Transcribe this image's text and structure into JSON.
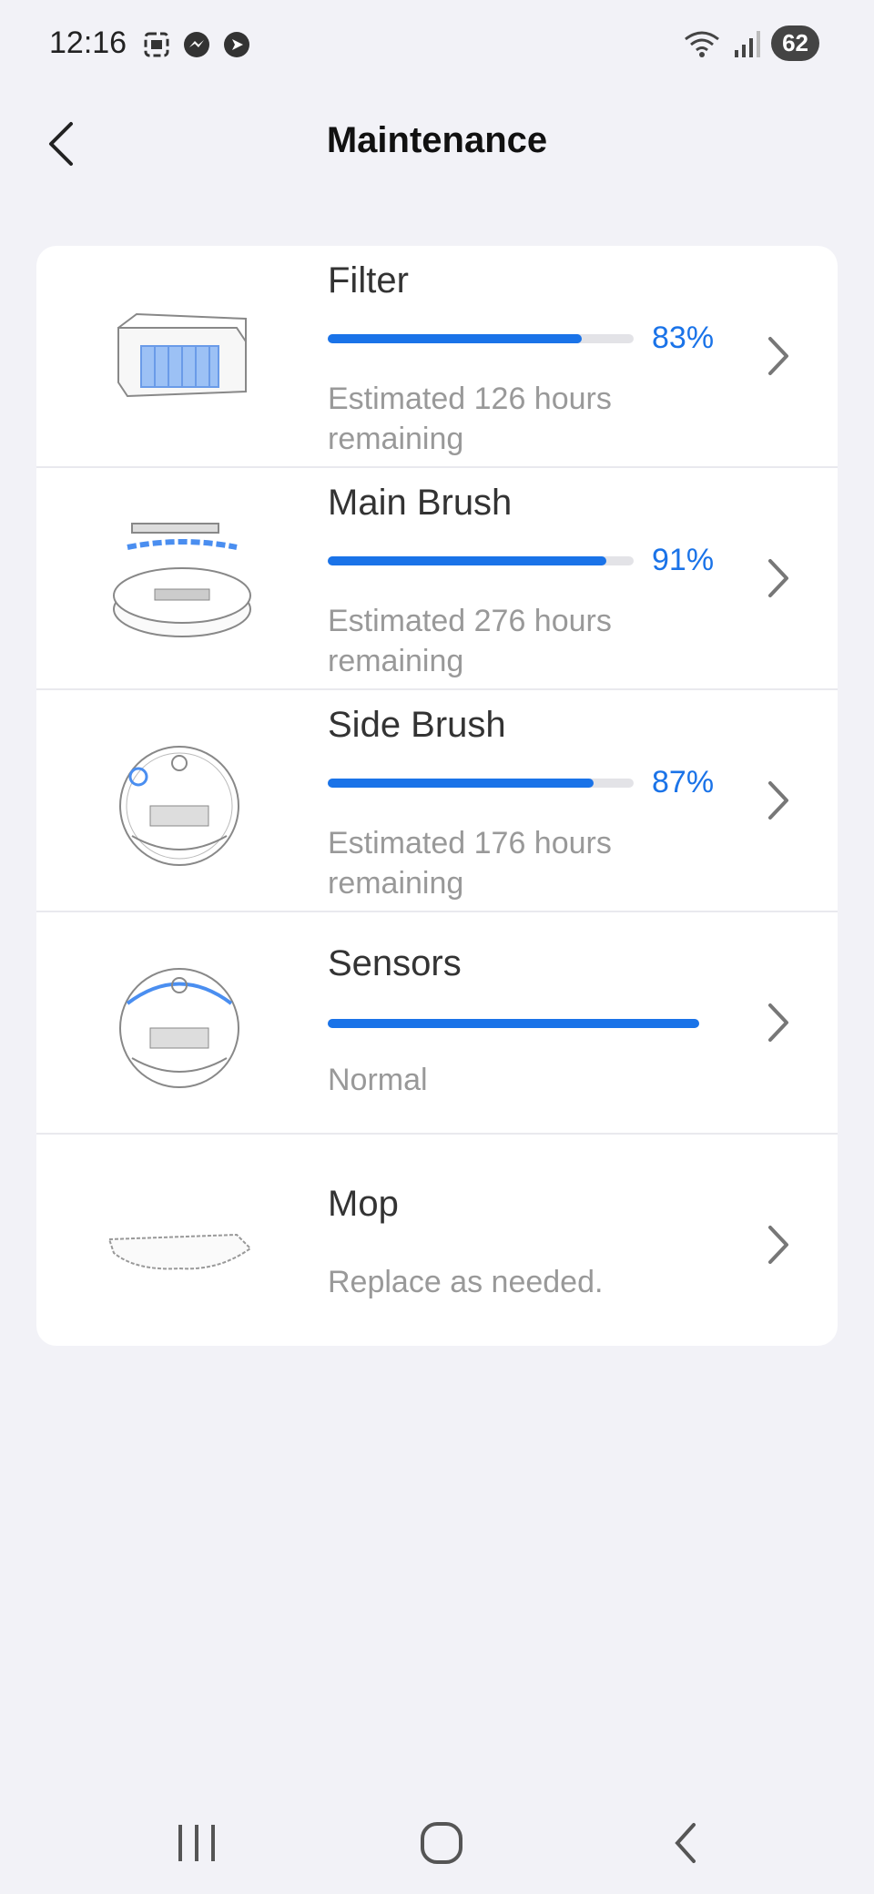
{
  "status_bar": {
    "time": "12:16",
    "battery": "62"
  },
  "header": {
    "title": "Maintenance"
  },
  "items": [
    {
      "name": "Filter",
      "percent": "83%",
      "level": 0.83,
      "desc": "Estimated 126 hours remaining"
    },
    {
      "name": "Main Brush",
      "percent": "91%",
      "level": 0.91,
      "desc": "Estimated 276 hours remaining"
    },
    {
      "name": "Side Brush",
      "percent": "87%",
      "level": 0.87,
      "desc": "Estimated 176 hours remaining"
    },
    {
      "name": "Sensors",
      "percent": "",
      "level": 1.0,
      "desc": "Normal"
    },
    {
      "name": "Mop",
      "desc": "Replace as needed."
    }
  ],
  "colors": {
    "accent": "#1a73e8",
    "background": "#f2f2f7",
    "card": "#ffffff"
  }
}
